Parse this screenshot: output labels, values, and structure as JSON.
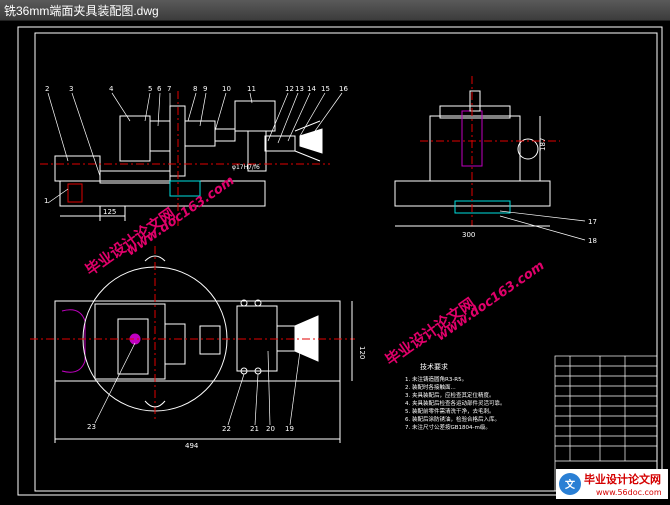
{
  "window": {
    "title": "铣36mm端面夹具装配图.dwg"
  },
  "drawing": {
    "part_numbers_top": [
      "2",
      "3",
      "4",
      "5",
      "6",
      "7",
      "8",
      "9",
      "10",
      "11",
      "12",
      "13",
      "14",
      "15",
      "16"
    ],
    "part_numbers_left": [
      "1"
    ],
    "part_numbers_bottom": [
      "23",
      "22",
      "21",
      "20",
      "19"
    ],
    "part_numbers_side": [
      "17",
      "18"
    ],
    "dimensions": {
      "top_width": "125",
      "bottom_length": "494",
      "side_width": "300",
      "side_height": "187",
      "plan_height": "120",
      "fit_label": "φ17H7/f6"
    },
    "tech_requirements": {
      "title": "技术要求",
      "lines": [
        "1. 未注铸造圆角R3-R5。",
        "2. 装配时各接触面...",
        "3. 夹具装配后，应检查其定位精度。",
        "4. 夹具装配后检查各运动部件灵活可靠。",
        "5. 装配前零件需清洗干净，去毛刺。",
        "6. 装配后涂防锈油，检验合格后入库。",
        "7. 未注尺寸公差按GB1804-m级。"
      ]
    }
  },
  "watermarks": {
    "brand": "毕业设计论文网",
    "url": "www.doc163.com"
  },
  "footer": {
    "brand": "毕业设计论文网",
    "url": "www.56doc.com"
  },
  "colors": {
    "line": "#ffffff",
    "center": "#e00000",
    "part": "#c000c0",
    "accent": "#00e0e0",
    "watermark": "#e0006a"
  }
}
